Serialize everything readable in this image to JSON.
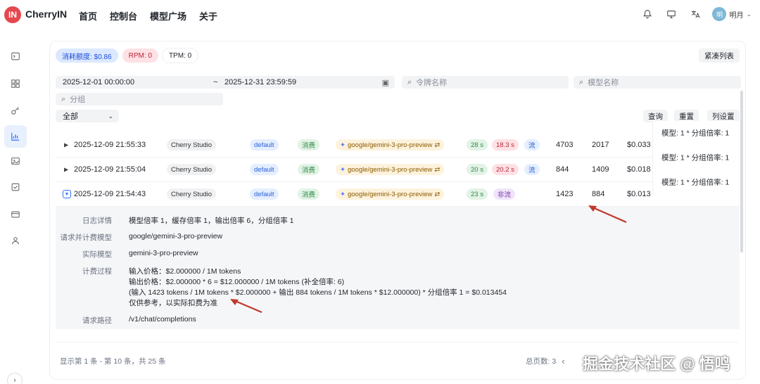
{
  "app": {
    "logo_text": "IN",
    "brand": "CherryIN"
  },
  "nav": [
    "首页",
    "控制台",
    "模型广场",
    "关于"
  ],
  "user": {
    "avatar_text": "明",
    "name": "明月"
  },
  "stats": {
    "quota": "消耗额度: $0.86",
    "rpm": "RPM: 0",
    "tpm": "TPM: 0"
  },
  "toolbar": {
    "compact": "紧凑列表",
    "query": "查询",
    "reset": "重置",
    "columns": "列设置"
  },
  "filters": {
    "start_time": "2025-12-01 00:00:00",
    "separator": "~",
    "end_time": "2025-12-31 23:59:59",
    "token_placeholder": "令牌名称",
    "model_placeholder": "模型名称",
    "group_placeholder": "分组",
    "type_value": "全部"
  },
  "rows": [
    {
      "time": "2025-12-09 21:55:33",
      "app": "Cherry Studio",
      "group": "default",
      "type": "消费",
      "model": "google/gemini-3-pro-preview",
      "first": "28 s",
      "total": "18.3 s",
      "stream": "流",
      "input": "4703",
      "output": "2017",
      "cost": "$0.033",
      "detail": "模型: 1 * 分组倍率: 1"
    },
    {
      "time": "2025-12-09 21:55:04",
      "app": "Cherry Studio",
      "group": "default",
      "type": "消费",
      "model": "google/gemini-3-pro-preview",
      "first": "20 s",
      "total": "20.2 s",
      "stream": "流",
      "input": "844",
      "output": "1409",
      "cost": "$0.018",
      "detail": "模型: 1 * 分组倍率: 1"
    },
    {
      "time": "2025-12-09 21:54:43",
      "app": "Cherry Studio",
      "group": "default",
      "type": "消费",
      "model": "google/gemini-3-pro-preview",
      "first": "23 s",
      "stream": "非流",
      "input": "1423",
      "output": "884",
      "cost": "$0.013",
      "detail": "模型: 1 * 分组倍率: 1"
    }
  ],
  "expanded": {
    "log_label": "日志详情",
    "log_value": "模型倍率 1，缓存倍率 1，输出倍率 6，分组倍率 1",
    "req_model_label": "请求并计费模型",
    "req_model_value": "google/gemini-3-pro-preview",
    "actual_model_label": "实际模型",
    "actual_model_value": "gemini-3-pro-preview",
    "billing_label": "计费过程",
    "billing_lines": [
      "输入价格：$2.000000 / 1M tokens",
      "输出价格：$2.000000 * 6 = $12.000000 / 1M tokens (补全倍率: 6)",
      "(输入 1423 tokens / 1M tokens * $2.000000 + 输出 884 tokens / 1M tokens * $12.000000) * 分组倍率 1 = $0.013454",
      "仅供参考，以实际扣费为准"
    ],
    "path_label": "请求路径",
    "path_value": "/v1/chat/completions"
  },
  "footer": {
    "summary": "显示第 1 条 - 第 10 条，共 25 条",
    "pages": "总页数: 3"
  },
  "watermark": "掘金技术社区 @ 悟鸣",
  "colors": {
    "accent": "#3370ff",
    "arrow": "#c0392b",
    "logo": "#e5484d"
  }
}
